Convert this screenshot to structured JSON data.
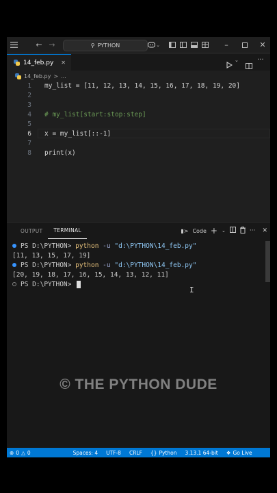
{
  "titlebar": {
    "search_label": "PYTHON",
    "icons": [
      "menu-icon",
      "back-arrow-icon",
      "forward-arrow-icon",
      "search-icon",
      "copilot-icon",
      "layout-icons",
      "minimize-icon",
      "maximize-icon",
      "close-icon"
    ]
  },
  "tab": {
    "filename": "14_feb.py"
  },
  "breadcrumb": {
    "file": "14_feb.py",
    "sep": ">",
    "more": "..."
  },
  "editor": {
    "lines": [
      {
        "num": "1",
        "text": "my_list = [11, 12, 13, 14, 15, 16, 17, 18, 19, 20]"
      },
      {
        "num": "2",
        "text": ""
      },
      {
        "num": "3",
        "text": ""
      },
      {
        "num": "4",
        "text": "# my_list[start:stop:step]"
      },
      {
        "num": "5",
        "text": ""
      },
      {
        "num": "6",
        "text": "x = my_list[::-1]"
      },
      {
        "num": "7",
        "text": ""
      },
      {
        "num": "8",
        "text": "print(x)"
      }
    ]
  },
  "panel": {
    "tabs": [
      "OUTPUT",
      "TERMINAL"
    ],
    "active_tab": "TERMINAL",
    "terminal_profile": "Code",
    "terminal": {
      "prompt": "PS D:\\PYTHON>",
      "cmd": "python",
      "flag": "-u",
      "path": "\"d:\\PYTHON\\14_feb.py\"",
      "output1": "[11, 13, 15, 17, 19]",
      "output2": "[20, 19, 18, 17, 16, 15, 14, 13, 12, 11]"
    }
  },
  "watermark": "© THE PYTHON DUDE",
  "statusbar": {
    "problems": "0",
    "warnings": "0",
    "spaces": "Spaces: 4",
    "encoding": "UTF-8",
    "eol": "CRLF",
    "language": "Python",
    "interpreter": "3.13.1 64-bit",
    "golive": "Go Live"
  },
  "colors": {
    "accent": "#0078d4",
    "comment": "#6a9955",
    "string": "#8fc8f5"
  }
}
